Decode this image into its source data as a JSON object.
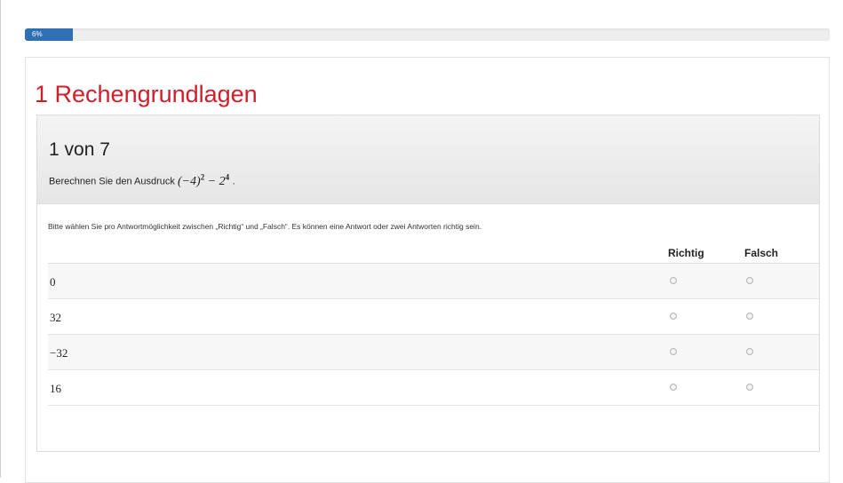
{
  "progress": {
    "label": "6%",
    "value_percent": 6
  },
  "chapter": {
    "title": "1 Rechengrundlagen"
  },
  "question": {
    "counter": "1 von 7",
    "prompt": "Berechnen Sie den Ausdruck",
    "expression_base": "(−4)",
    "expression_exp1": "2",
    "expression_minus": " − 2",
    "expression_exp2": "4",
    "expression_end": " ."
  },
  "instruction": "Bitte wählen Sie pro Antwortmöglichkeit zwischen „Richtig“ und „Falsch“. Es können eine Antwort oder zwei Antworten richtig sein.",
  "columns": {
    "correct": "Richtig",
    "wrong": "Falsch"
  },
  "answers": [
    {
      "label": "0"
    },
    {
      "label": "32"
    },
    {
      "label": "−32"
    },
    {
      "label": "16"
    }
  ],
  "colors": {
    "accent": "#d01f2a",
    "progress": "#2f6fb4"
  }
}
